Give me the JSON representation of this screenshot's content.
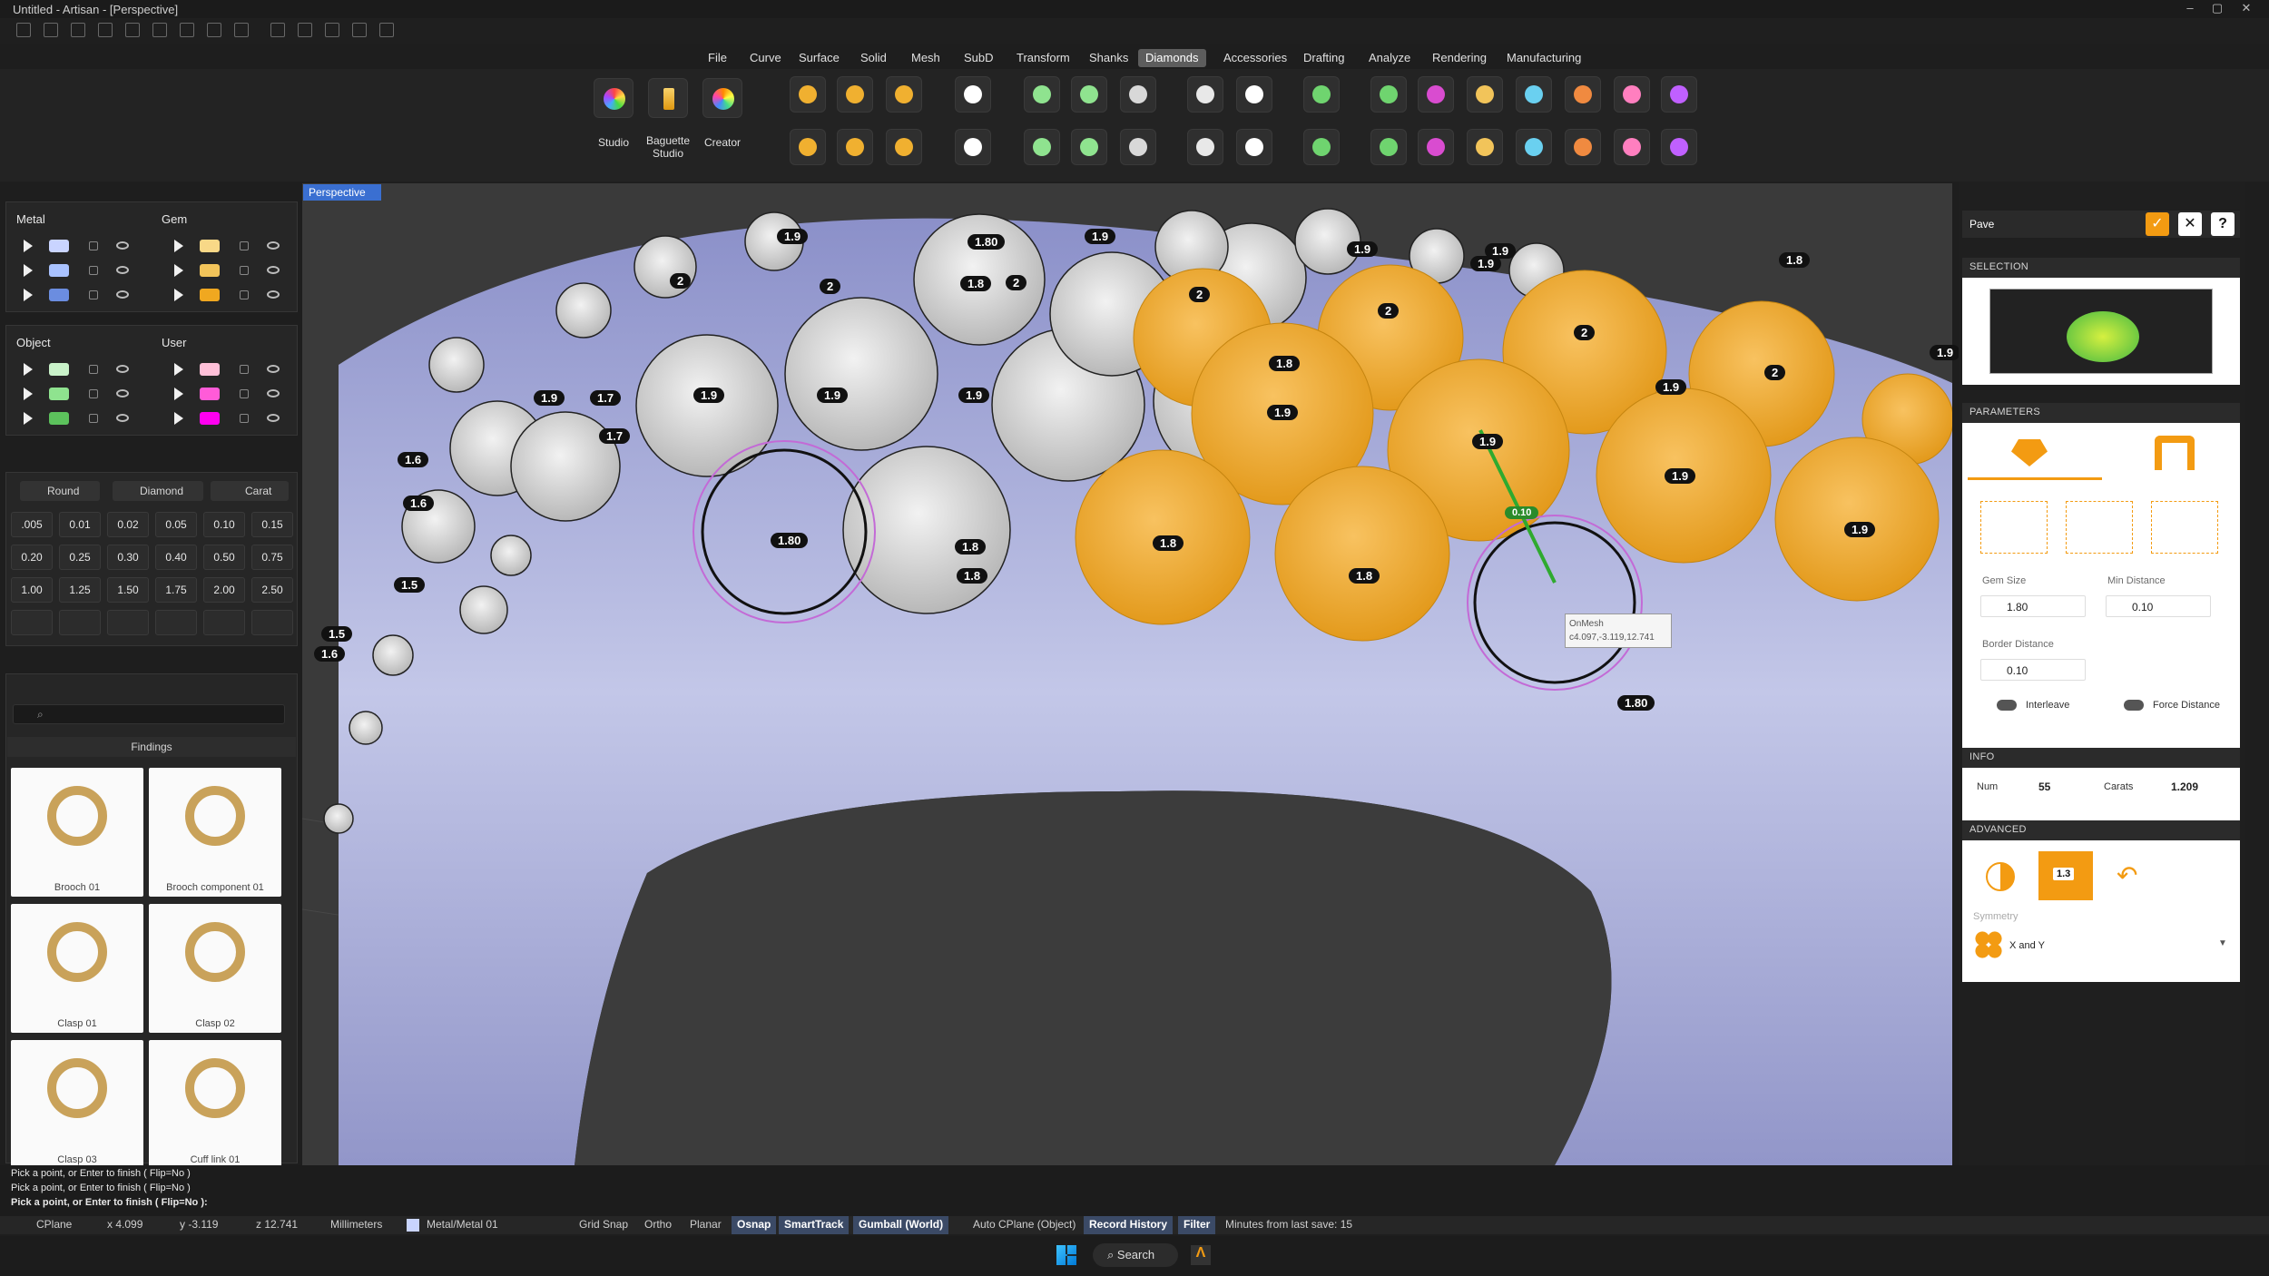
{
  "window": {
    "title": "Untitled - Artisan - [Perspective]"
  },
  "menu": [
    "File",
    "Curve",
    "Surface",
    "Solid",
    "Mesh",
    "SubD",
    "Transform",
    "Shanks",
    "Diamonds",
    "Accessories",
    "Drafting",
    "Analyze",
    "Rendering",
    "Manufacturing"
  ],
  "menu_active": "Diamonds",
  "ribbon": {
    "studio": "Studio",
    "baguette": "Baguette Studio",
    "creator": "Creator"
  },
  "layers": {
    "metal": {
      "title": "Metal",
      "colors": [
        "#c9d4ff",
        "#a9c2ff",
        "#6b8de0"
      ]
    },
    "gem": {
      "title": "Gem",
      "colors": [
        "#f8d887",
        "#f2c45a",
        "#f0a820"
      ]
    },
    "object": {
      "title": "Object",
      "colors": [
        "#c9f2c9",
        "#8fe38f",
        "#5cc25c"
      ]
    },
    "user": {
      "title": "User",
      "colors": [
        "#ffc0d8",
        "#ff5bd8",
        "#ff00f0"
      ]
    }
  },
  "gemtype": {
    "shape": "Round",
    "cut": "Diamond",
    "unit": "Carat"
  },
  "sizes": [
    ".005",
    "0.01",
    "0.02",
    "0.05",
    "0.10",
    "0.15",
    "0.20",
    "0.25",
    "0.30",
    "0.40",
    "0.50",
    "0.75",
    "1.00",
    "1.25",
    "1.50",
    "1.75",
    "2.00",
    "2.50"
  ],
  "library": {
    "section": "Findings",
    "search_placeholder": "",
    "items": [
      "Brooch 01",
      "Brooch component 01",
      "Clasp 01",
      "Clasp 02",
      "Clasp 03",
      "Cuff link 01"
    ]
  },
  "viewport": {
    "name": "Perspective",
    "tooltip_title": "OnMesh",
    "tooltip_coords": "c4.097,-3.119,12.741",
    "distance_label": "0.10"
  },
  "gem_labels": {
    "white": [
      "1.9",
      "1.9",
      "1.9",
      "1.9",
      "1.9",
      "1.8",
      "1.8",
      "1.8",
      "1.7",
      "1.7",
      "1.6",
      "1.6",
      "1.6",
      "1.5",
      "1.5",
      "1.9",
      "1.9",
      "1.9",
      "1.9",
      "2",
      "2",
      "2",
      "1.8",
      "1.80",
      "1.80"
    ],
    "gold": [
      "2",
      "2",
      "2",
      "2",
      "1.9",
      "1.9",
      "1.9",
      "1.9",
      "1.9",
      "1.8",
      "1.8",
      "1.80",
      "1.9",
      "1.8",
      "1.9",
      "1.9"
    ]
  },
  "right": {
    "tool": "Pave",
    "selection": "SELECTION",
    "parameters": "PARAMETERS",
    "gem_size_label": "Gem Size",
    "gem_size": "1.80",
    "min_distance_label": "Min Distance",
    "min_distance": "0.10",
    "border_distance_label": "Border Distance",
    "border_distance": "0.10",
    "interleave": "Interleave",
    "force_distance": "Force Distance",
    "info": "INFO",
    "num_label": "Num",
    "num": "55",
    "carats_label": "Carats",
    "carats": "1.209",
    "advanced": "ADVANCED",
    "adv_value": "1.3",
    "symmetry_label": "Symmetry",
    "symmetry": "X and Y",
    "accent": "#f39b12"
  },
  "command": {
    "lines": [
      "Pick a point, or Enter to finish ( Flip=No )",
      "Pick a point, or Enter to finish ( Flip=No )",
      "Pick a point, or Enter to finish ( Flip=No ):"
    ]
  },
  "status": {
    "cplane": "CPlane",
    "x": "x 4.099",
    "y": "y -3.119",
    "z": "z 12.741",
    "units": "Millimeters",
    "layer": "Metal/Metal 01",
    "grid_snap": "Grid Snap",
    "ortho": "Ortho",
    "planar": "Planar",
    "osnap": "Osnap",
    "smarttrack": "SmartTrack",
    "gumball": "Gumball (World)",
    "autocplane": "Auto CPlane (Object)",
    "record_history": "Record History",
    "filter": "Filter",
    "minutes": "Minutes from last save: 15"
  },
  "taskbar": {
    "search": "Search"
  }
}
